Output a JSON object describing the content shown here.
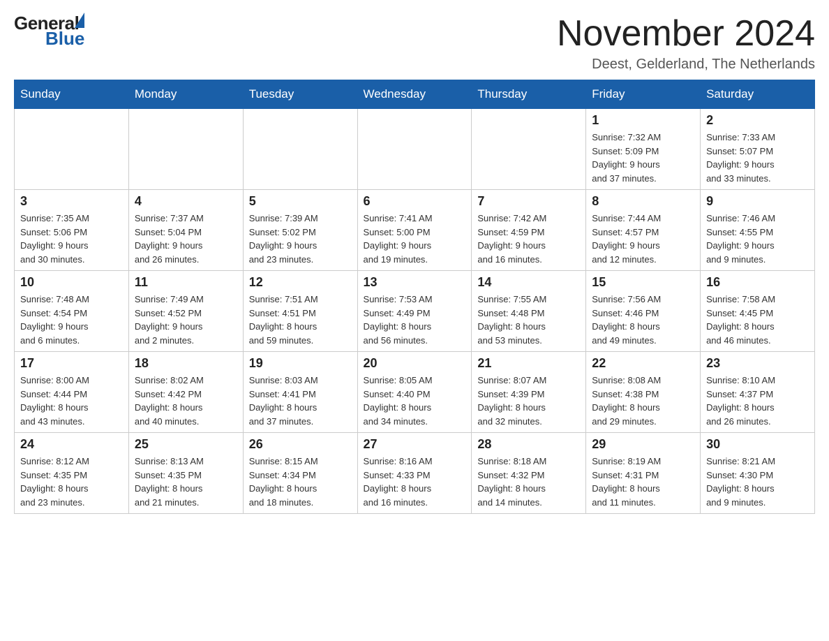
{
  "logo": {
    "text_general": "General",
    "text_blue": "Blue"
  },
  "header": {
    "month_year": "November 2024",
    "location": "Deest, Gelderland, The Netherlands"
  },
  "weekdays": [
    "Sunday",
    "Monday",
    "Tuesday",
    "Wednesday",
    "Thursday",
    "Friday",
    "Saturday"
  ],
  "weeks": [
    [
      {
        "day": "",
        "info": ""
      },
      {
        "day": "",
        "info": ""
      },
      {
        "day": "",
        "info": ""
      },
      {
        "day": "",
        "info": ""
      },
      {
        "day": "",
        "info": ""
      },
      {
        "day": "1",
        "info": "Sunrise: 7:32 AM\nSunset: 5:09 PM\nDaylight: 9 hours\nand 37 minutes."
      },
      {
        "day": "2",
        "info": "Sunrise: 7:33 AM\nSunset: 5:07 PM\nDaylight: 9 hours\nand 33 minutes."
      }
    ],
    [
      {
        "day": "3",
        "info": "Sunrise: 7:35 AM\nSunset: 5:06 PM\nDaylight: 9 hours\nand 30 minutes."
      },
      {
        "day": "4",
        "info": "Sunrise: 7:37 AM\nSunset: 5:04 PM\nDaylight: 9 hours\nand 26 minutes."
      },
      {
        "day": "5",
        "info": "Sunrise: 7:39 AM\nSunset: 5:02 PM\nDaylight: 9 hours\nand 23 minutes."
      },
      {
        "day": "6",
        "info": "Sunrise: 7:41 AM\nSunset: 5:00 PM\nDaylight: 9 hours\nand 19 minutes."
      },
      {
        "day": "7",
        "info": "Sunrise: 7:42 AM\nSunset: 4:59 PM\nDaylight: 9 hours\nand 16 minutes."
      },
      {
        "day": "8",
        "info": "Sunrise: 7:44 AM\nSunset: 4:57 PM\nDaylight: 9 hours\nand 12 minutes."
      },
      {
        "day": "9",
        "info": "Sunrise: 7:46 AM\nSunset: 4:55 PM\nDaylight: 9 hours\nand 9 minutes."
      }
    ],
    [
      {
        "day": "10",
        "info": "Sunrise: 7:48 AM\nSunset: 4:54 PM\nDaylight: 9 hours\nand 6 minutes."
      },
      {
        "day": "11",
        "info": "Sunrise: 7:49 AM\nSunset: 4:52 PM\nDaylight: 9 hours\nand 2 minutes."
      },
      {
        "day": "12",
        "info": "Sunrise: 7:51 AM\nSunset: 4:51 PM\nDaylight: 8 hours\nand 59 minutes."
      },
      {
        "day": "13",
        "info": "Sunrise: 7:53 AM\nSunset: 4:49 PM\nDaylight: 8 hours\nand 56 minutes."
      },
      {
        "day": "14",
        "info": "Sunrise: 7:55 AM\nSunset: 4:48 PM\nDaylight: 8 hours\nand 53 minutes."
      },
      {
        "day": "15",
        "info": "Sunrise: 7:56 AM\nSunset: 4:46 PM\nDaylight: 8 hours\nand 49 minutes."
      },
      {
        "day": "16",
        "info": "Sunrise: 7:58 AM\nSunset: 4:45 PM\nDaylight: 8 hours\nand 46 minutes."
      }
    ],
    [
      {
        "day": "17",
        "info": "Sunrise: 8:00 AM\nSunset: 4:44 PM\nDaylight: 8 hours\nand 43 minutes."
      },
      {
        "day": "18",
        "info": "Sunrise: 8:02 AM\nSunset: 4:42 PM\nDaylight: 8 hours\nand 40 minutes."
      },
      {
        "day": "19",
        "info": "Sunrise: 8:03 AM\nSunset: 4:41 PM\nDaylight: 8 hours\nand 37 minutes."
      },
      {
        "day": "20",
        "info": "Sunrise: 8:05 AM\nSunset: 4:40 PM\nDaylight: 8 hours\nand 34 minutes."
      },
      {
        "day": "21",
        "info": "Sunrise: 8:07 AM\nSunset: 4:39 PM\nDaylight: 8 hours\nand 32 minutes."
      },
      {
        "day": "22",
        "info": "Sunrise: 8:08 AM\nSunset: 4:38 PM\nDaylight: 8 hours\nand 29 minutes."
      },
      {
        "day": "23",
        "info": "Sunrise: 8:10 AM\nSunset: 4:37 PM\nDaylight: 8 hours\nand 26 minutes."
      }
    ],
    [
      {
        "day": "24",
        "info": "Sunrise: 8:12 AM\nSunset: 4:35 PM\nDaylight: 8 hours\nand 23 minutes."
      },
      {
        "day": "25",
        "info": "Sunrise: 8:13 AM\nSunset: 4:35 PM\nDaylight: 8 hours\nand 21 minutes."
      },
      {
        "day": "26",
        "info": "Sunrise: 8:15 AM\nSunset: 4:34 PM\nDaylight: 8 hours\nand 18 minutes."
      },
      {
        "day": "27",
        "info": "Sunrise: 8:16 AM\nSunset: 4:33 PM\nDaylight: 8 hours\nand 16 minutes."
      },
      {
        "day": "28",
        "info": "Sunrise: 8:18 AM\nSunset: 4:32 PM\nDaylight: 8 hours\nand 14 minutes."
      },
      {
        "day": "29",
        "info": "Sunrise: 8:19 AM\nSunset: 4:31 PM\nDaylight: 8 hours\nand 11 minutes."
      },
      {
        "day": "30",
        "info": "Sunrise: 8:21 AM\nSunset: 4:30 PM\nDaylight: 8 hours\nand 9 minutes."
      }
    ]
  ]
}
